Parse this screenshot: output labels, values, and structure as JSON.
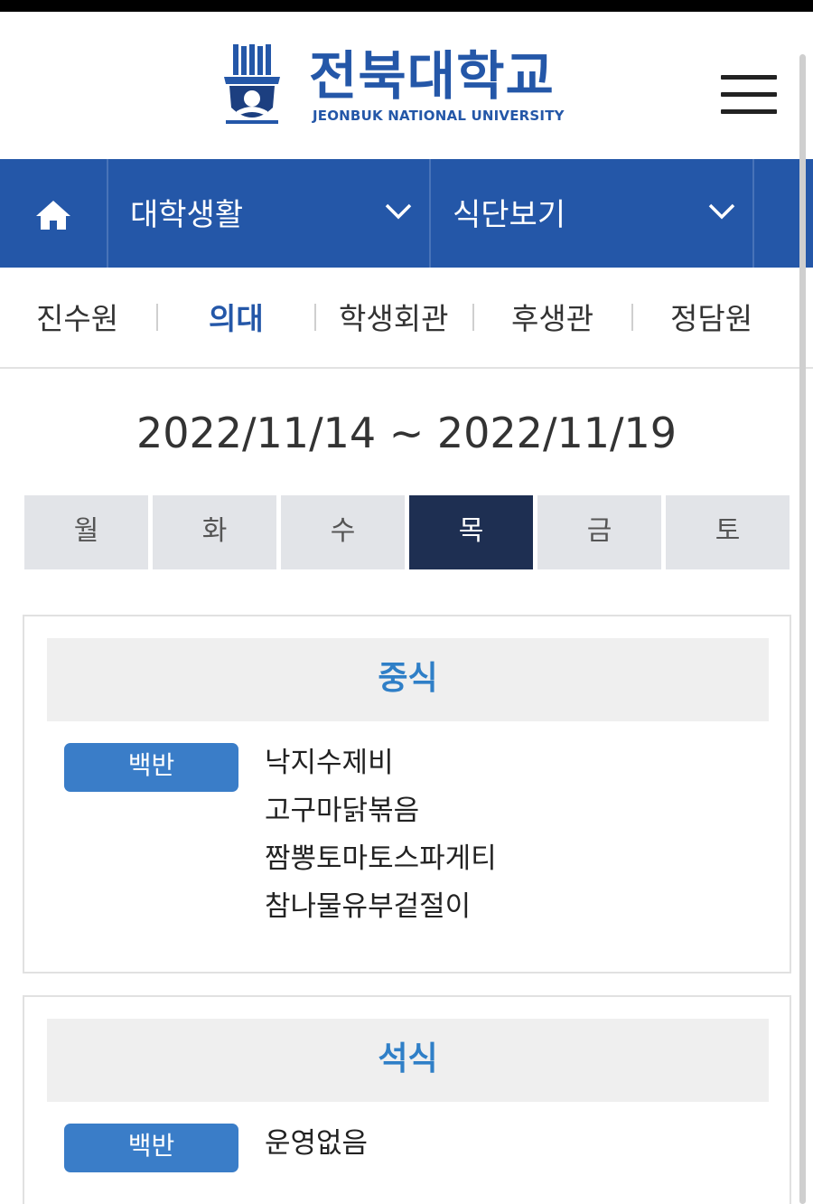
{
  "header": {
    "logo_kr": "전북대학교",
    "logo_en": "JEONBUK NATIONAL UNIVERSITY",
    "brand_color": "#2457a8"
  },
  "nav": {
    "home_icon": "home-icon",
    "menu1": "대학생활",
    "menu2": "식단보기"
  },
  "subnav": {
    "items": [
      "진수원",
      "의대",
      "학생회관",
      "후생관",
      "정담원"
    ],
    "active": "의대"
  },
  "date_range": "2022/11/14 ~ 2022/11/19",
  "days": {
    "items": [
      "월",
      "화",
      "수",
      "목",
      "금",
      "토"
    ],
    "active": "목"
  },
  "meals": [
    {
      "title": "중식",
      "badge": "백반",
      "items": [
        "낙지수제비",
        "고구마닭볶음",
        "짬뽕토마토스파게티",
        "참나물유부겉절이"
      ]
    },
    {
      "title": "석식",
      "badge": "백반",
      "items": [
        "운영없음"
      ]
    }
  ]
}
